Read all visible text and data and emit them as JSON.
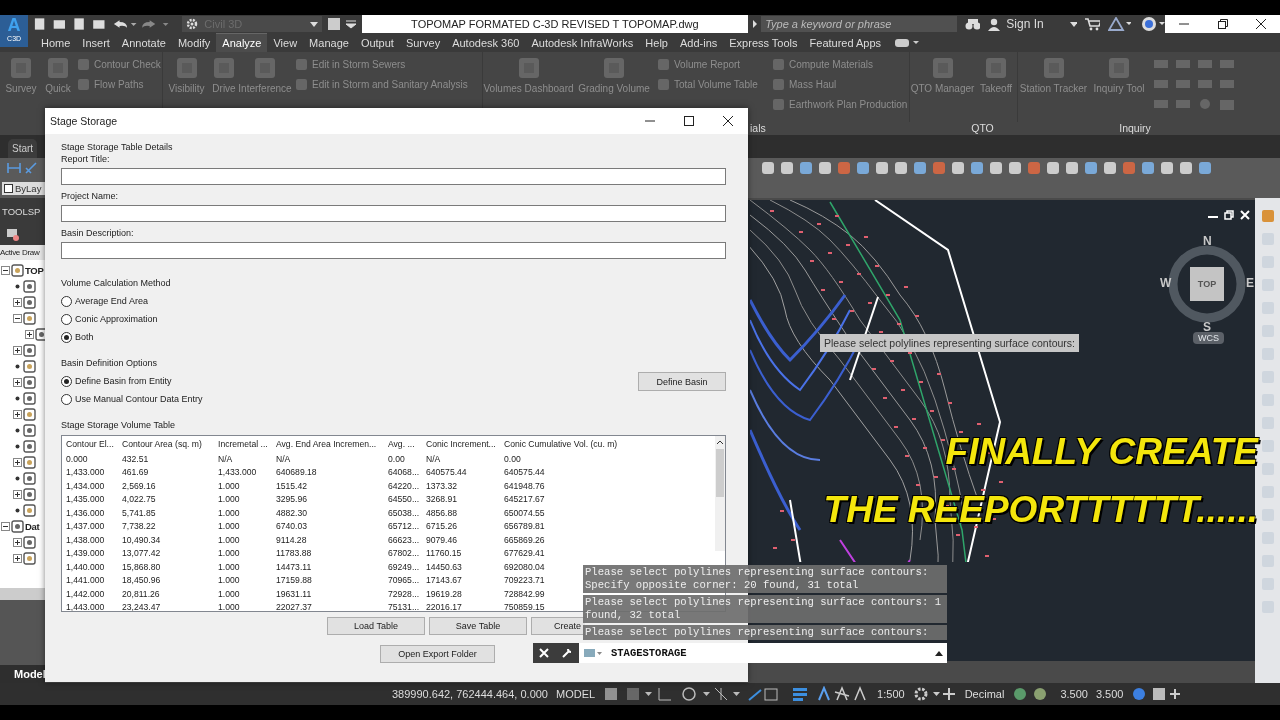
{
  "app_bar": {
    "logo_letter": "A",
    "logo_text": "C3D",
    "workspace": "Civil 3D",
    "title": "TOPOMAP FORMATED C-3D REVISED T  TOPOMAP.dwg",
    "search": {
      "placeholder": "Type a keyword or phrase"
    },
    "sign_in": "Sign In"
  },
  "menu_tabs": [
    {
      "label": "Home",
      "selected": false
    },
    {
      "label": "Insert",
      "selected": false
    },
    {
      "label": "Annotate",
      "selected": false
    },
    {
      "label": "Modify",
      "selected": false
    },
    {
      "label": "Analyze",
      "selected": true
    },
    {
      "label": "View",
      "selected": false
    },
    {
      "label": "Manage",
      "selected": false
    },
    {
      "label": "Output",
      "selected": false
    },
    {
      "label": "Survey",
      "selected": false
    },
    {
      "label": "Autodesk 360",
      "selected": false
    },
    {
      "label": "Autodesk InfraWorks",
      "selected": false
    },
    {
      "label": "Help",
      "selected": false
    },
    {
      "label": "Add-ins",
      "selected": false
    },
    {
      "label": "Express Tools",
      "selected": false
    },
    {
      "label": "Featured Apps",
      "selected": false
    }
  ],
  "ribbon": {
    "groups": [
      {
        "kind": "big",
        "label": "Survey"
      },
      {
        "kind": "big",
        "label": "Quick"
      },
      {
        "kind": "list",
        "items": [
          "Contour Check",
          "Flow Paths"
        ]
      },
      {
        "kind": "big",
        "label": "Visibility"
      },
      {
        "kind": "big",
        "label": "Drive"
      },
      {
        "kind": "big",
        "label": "Interference"
      },
      {
        "kind": "list",
        "items": [
          "Edit in Storm Sewers",
          "Edit in Storm and Sanitary Analysis"
        ]
      },
      {
        "kind": "big",
        "label": "Volumes Dashboard"
      },
      {
        "kind": "big",
        "label": "Grading Volume"
      },
      {
        "kind": "list",
        "items": [
          "Volume Report",
          "Total Volume Table"
        ]
      },
      {
        "kind": "list",
        "items": [
          "Compute Materials",
          "Mass Haul",
          "Earthwork Plan Production"
        ]
      },
      {
        "kind": "big",
        "label": "QTO Manager"
      },
      {
        "kind": "big",
        "label": "Takeoff"
      },
      {
        "kind": "big",
        "label": "Station Tracker"
      },
      {
        "kind": "big",
        "label": "Inquiry Tool"
      },
      {
        "kind": "icons"
      }
    ],
    "panels": [
      {
        "label": "ials"
      },
      {
        "label": "QTO"
      },
      {
        "label": "Inquiry"
      }
    ]
  },
  "palette": {
    "doc_tab": "Start",
    "layer": "ByLay",
    "title": "TOOLSP",
    "header": "Active Draw",
    "tree": [
      {
        "label": "TOP",
        "expanded": true,
        "children": [
          {
            "kind": "leaf"
          },
          {
            "expanded": false
          },
          {
            "expanded": true,
            "children": [
              {
                "expanded": false
              }
            ]
          },
          {
            "expanded": false
          },
          {
            "kind": "leaf"
          },
          {
            "expanded": false
          },
          {
            "kind": "leaf"
          },
          {
            "expanded": false
          },
          {
            "kind": "leaf"
          },
          {
            "kind": "leaf"
          },
          {
            "expanded": false
          },
          {
            "kind": "leaf"
          },
          {
            "expanded": false
          },
          {
            "kind": "leaf"
          }
        ]
      },
      {
        "label": "Dat",
        "expanded": true,
        "children": [
          {
            "expanded": false
          },
          {
            "expanded": false
          }
        ]
      }
    ],
    "layout_tab": "Model"
  },
  "viewport": {
    "tooltip": "Please select polylines representing surface contours:",
    "compass": {
      "north": "N",
      "west": "W",
      "east": "E",
      "south": "S",
      "cube": "TOP",
      "ucs": "WCS"
    },
    "caption": [
      "FINALLY CREATE",
      "THE REEPORTTTTTT......"
    ]
  },
  "dialog": {
    "title": "Stage Storage",
    "section": "Stage Storage Table Details",
    "fields": [
      {
        "label": "Report Title:"
      },
      {
        "label": "Project Name:"
      },
      {
        "label": "Basin Description:"
      }
    ],
    "method": {
      "label": "Volume Calculation Method",
      "options": [
        {
          "label": "Average End Area",
          "selected": false
        },
        {
          "label": "Conic Approximation",
          "selected": false
        },
        {
          "label": "Both",
          "selected": true
        }
      ]
    },
    "basin": {
      "label": "Basin Definition Options",
      "options": [
        {
          "label": "Define Basin from Entity",
          "selected": true
        },
        {
          "label": "Use Manual Contour Data Entry",
          "selected": false
        }
      ],
      "button": "Define Basin"
    },
    "table": {
      "title": "Stage Storage Volume Table",
      "columns": [
        "Contour El...",
        "Contour Area (sq. m)",
        "Incremetal ...",
        "Avg. End Area Incremen...",
        "Avg. ...",
        "Conic Increment...",
        "Conic Cumulative Vol. (cu. m)"
      ],
      "rows": [
        [
          "0.000",
          "432.51",
          "N/A",
          "N/A",
          "0.00",
          "N/A",
          "0.00"
        ],
        [
          "1,433.000",
          "461.69",
          "1,433.000",
          "640689.18",
          "64068...",
          "640575.44",
          "640575.44"
        ],
        [
          "1,434.000",
          "2,569.16",
          "1.000",
          "1515.42",
          "64220...",
          "1373.32",
          "641948.76"
        ],
        [
          "1,435.000",
          "4,022.75",
          "1.000",
          "3295.96",
          "64550...",
          "3268.91",
          "645217.67"
        ],
        [
          "1,436.000",
          "5,741.85",
          "1.000",
          "4882.30",
          "65038...",
          "4856.88",
          "650074.55"
        ],
        [
          "1,437.000",
          "7,738.22",
          "1.000",
          "6740.03",
          "65712...",
          "6715.26",
          "656789.81"
        ],
        [
          "1,438.000",
          "10,490.34",
          "1.000",
          "9114.28",
          "66623...",
          "9079.46",
          "665869.26"
        ],
        [
          "1,439.000",
          "13,077.42",
          "1.000",
          "11783.88",
          "67802...",
          "11760.15",
          "677629.41"
        ],
        [
          "1,440.000",
          "15,868.80",
          "1.000",
          "14473.11",
          "69249...",
          "14450.63",
          "692080.04"
        ],
        [
          "1,441.000",
          "18,450.96",
          "1.000",
          "17159.88",
          "70965...",
          "17143.67",
          "709223.71"
        ],
        [
          "1,442.000",
          "20,811.26",
          "1.000",
          "19631.11",
          "72928...",
          "19619.28",
          "728842.99"
        ],
        [
          "1,443.000",
          "23,243.47",
          "1.000",
          "22027.37",
          "75131...",
          "22016.17",
          "750859.15"
        ]
      ]
    },
    "buttons": [
      "Load Table",
      "Save Table",
      "Create"
    ],
    "export_button": "Open Export Folder"
  },
  "command_line": {
    "history": [
      [
        "Please select polylines representing surface contours:",
        "Specify opposite corner: 20 found, 31 total"
      ],
      [
        "Please select polylines representing surface contours: 1",
        "found, 32 total"
      ],
      [
        "Please select polylines representing surface contours:"
      ]
    ],
    "input": "STAGESTORAGE"
  },
  "status_bar": {
    "coordinates": "389990.642, 762444.464, 0.000",
    "space": "MODEL",
    "scale": "1:500",
    "units": "Decimal",
    "values": [
      "3.500",
      "3.500"
    ]
  }
}
